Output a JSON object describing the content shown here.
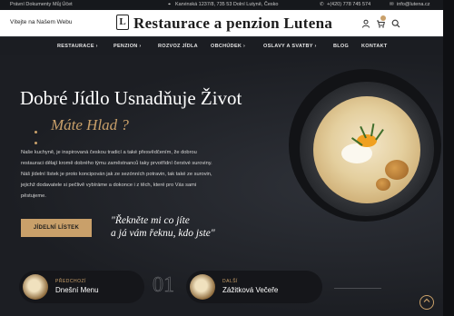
{
  "topbar": {
    "left_links": [
      "Právní Dokumenty",
      "Můj Účet"
    ],
    "address": "Karvinská 1237/8, 735 53 Dolní Lutyně, Česko",
    "phone": "+(420) 778 745 574",
    "email": "info@lutena.cz"
  },
  "header": {
    "welcome": "Vítejte na Našem Webu",
    "logo_mark": "L",
    "logo_title": "Restaurace a penzion Lutena"
  },
  "nav": {
    "items": [
      "RESTAURACE ›",
      "PENZION ›",
      "ROZVOZ JÍDLA",
      "OBCHÚDEK ›",
      "OSLAVY A SVATBY ›",
      "BLOG",
      "KONTAKT"
    ]
  },
  "hero": {
    "title": "Dobré Jídlo Usnadňuje Život",
    "subtitle": "Máte Hlad ?",
    "paragraph": "Naše kuchyně, je inspirovaná českou tradicí a také přesvědčením, že dobrou restauraci dělají kromě dobrého týmu zaměstnanců taky prvotřídní čerstvé suroviny. Náš jídelní lístek je proto koncipován jak ze sezónních potravin, tak také ze surovin, jejichž dodavatele si pečlivě vybíráme a dokonce i z těch, které pro Vás sami pěstujeme.",
    "button": "JÍDELNÍ LÍSTEK",
    "quote_line1": "\"Řekněte mi co jíte",
    "quote_line2": "a já vám řeknu, kdo jste\""
  },
  "slider": {
    "prev_label": "PŘEDCHOZÍ",
    "prev_title": "Dnešní Menu",
    "number": "01",
    "next_label": "DALŠÍ",
    "next_title": "Zážitková Večeře"
  },
  "colors": {
    "accent": "#c9a06a",
    "background": "#1f2126"
  },
  "icons": [
    "location-icon",
    "phone-icon",
    "email-icon",
    "user-icon",
    "cart-icon",
    "search-icon",
    "arrow-up-icon"
  ]
}
